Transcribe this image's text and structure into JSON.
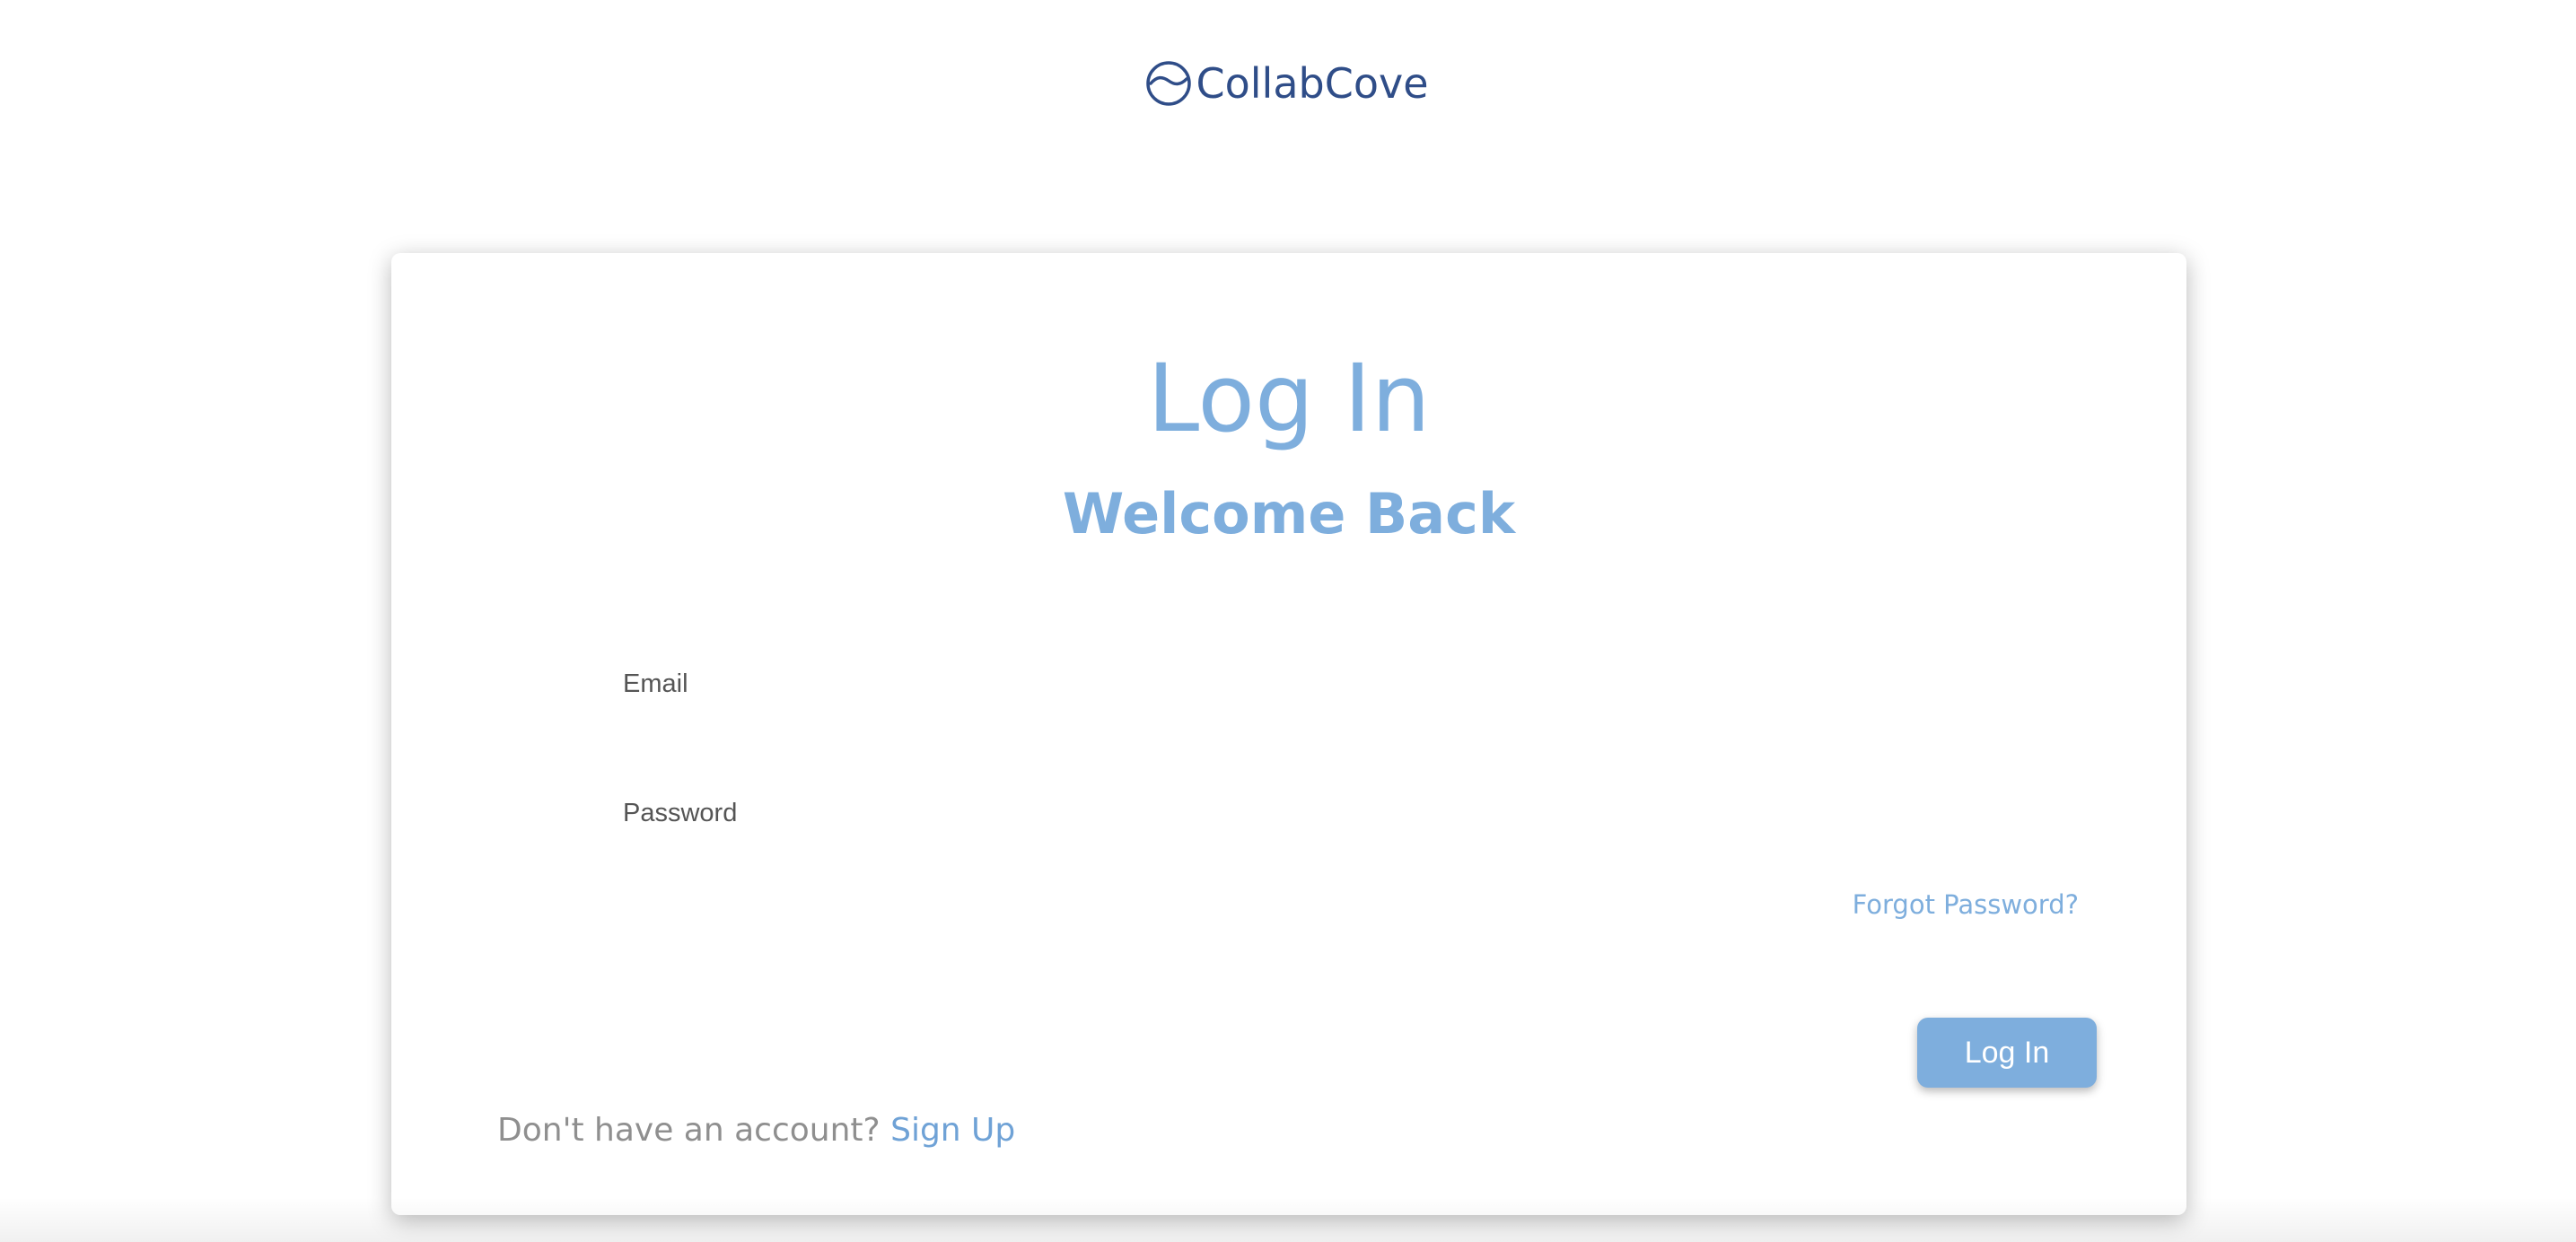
{
  "brand": {
    "name": "CollabCove",
    "logo_icon": "wave-circle-logo-icon",
    "color": "#2f4d88"
  },
  "login_card": {
    "title": "Log In",
    "subtitle": "Welcome Back",
    "accent_color": "#7eaedd",
    "email_field": {
      "label": "Email",
      "value": "",
      "placeholder": ""
    },
    "password_field": {
      "label": "Password",
      "value": "",
      "placeholder": ""
    },
    "forgot_password_label": "Forgot Password?",
    "submit_label": "Log In",
    "signup_prompt": "Don't have an account?",
    "signup_link_label": "Sign Up"
  }
}
